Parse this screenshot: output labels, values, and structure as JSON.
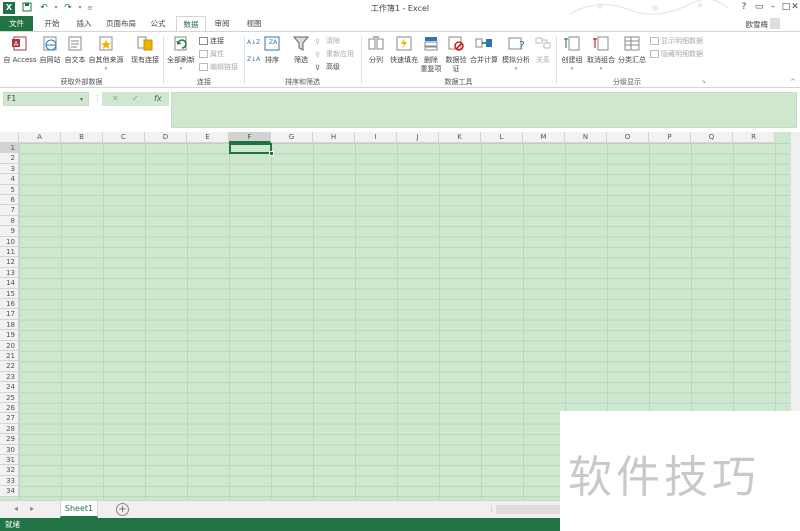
{
  "app": {
    "title": "工作簿1 - Excel",
    "user": "欧雪梅",
    "quick_access": [
      "save-icon",
      "undo-icon",
      "redo-icon",
      "customize-icon"
    ]
  },
  "tabs": [
    {
      "label": "文件"
    },
    {
      "label": "开始"
    },
    {
      "label": "插入"
    },
    {
      "label": "页面布局"
    },
    {
      "label": "公式"
    },
    {
      "label": "数据"
    },
    {
      "label": "审阅"
    },
    {
      "label": "视图"
    }
  ],
  "active_tab": "数据",
  "ribbon": {
    "get_external": {
      "label": "获取外部数据",
      "buttons": [
        "自 Access",
        "自网站",
        "自文本",
        "自其他来源",
        "现有连接"
      ]
    },
    "connections": {
      "label": "连接",
      "refresh": "全部刷新",
      "small": [
        "连接",
        "属性",
        "编辑链接"
      ]
    },
    "sort_filter": {
      "label": "排序和筛选",
      "sort": "排序",
      "filter": "筛选",
      "small": [
        "清除",
        "重新应用",
        "高级"
      ]
    },
    "data_tools": {
      "label": "数据工具",
      "buttons": [
        "分列",
        "快速填充",
        "删除\n重复项",
        "数据验\n证",
        "合并计算",
        "模拟分析",
        "关系"
      ]
    },
    "outline": {
      "label": "分级显示",
      "buttons": [
        "创建组",
        "取消组合",
        "分类汇总"
      ],
      "small": [
        "显示明细数据",
        "隐藏明细数据"
      ]
    }
  },
  "formula_bar": {
    "name_box": "F1",
    "fx": "fx",
    "value": ""
  },
  "columns": [
    "A",
    "B",
    "C",
    "D",
    "E",
    "F",
    "G",
    "H",
    "I",
    "J",
    "K",
    "L",
    "M",
    "N",
    "O",
    "P",
    "Q",
    "R"
  ],
  "rows": [
    "1",
    "2",
    "3",
    "4",
    "5",
    "6",
    "7",
    "8",
    "9",
    "10",
    "11",
    "12",
    "13",
    "14",
    "15",
    "16",
    "17",
    "18",
    "19",
    "20",
    "21",
    "22",
    "23",
    "24",
    "25",
    "26",
    "27",
    "28",
    "29",
    "30",
    "31",
    "32",
    "33",
    "34"
  ],
  "selected_cell": "F1",
  "sheets": [
    "Sheet1"
  ],
  "status": "就绪",
  "watermark": "软件技巧",
  "colors": {
    "accent": "#217346",
    "grid_bg": "#cce8cf"
  }
}
